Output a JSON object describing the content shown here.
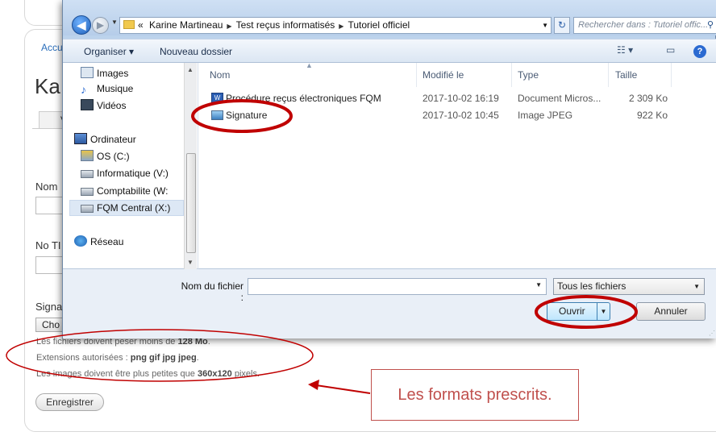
{
  "page": {
    "breadcrumb": "Accu",
    "title": "Ka",
    "tab_stub": "V",
    "field1_label": "Nom",
    "field2_label": "No TI",
    "signature_label": "Signa",
    "choose_button": "Cho",
    "hints": [
      {
        "before": "Les fichiers doivent peser moins de ",
        "bold": "128 Mo",
        "after": "."
      },
      {
        "before": "Extensions autorisées : ",
        "bold": "png gif jpg jpeg",
        "after": "."
      },
      {
        "before": "Les images doivent être plus petites que ",
        "bold": "360x120",
        "after": " pixels."
      }
    ],
    "save_button": "Enregistrer"
  },
  "dialog": {
    "address_parts": [
      "Karine Martineau",
      "Test reçus informatisés",
      "Tutoriel officiel"
    ],
    "address_prefix": "«",
    "search_placeholder": "Rechercher dans : Tutoriel offic...",
    "toolbar": {
      "organize": "Organiser ▾",
      "new_folder": "Nouveau dossier"
    },
    "nav_items": [
      {
        "label": "Images",
        "icon": "pictures-icon"
      },
      {
        "label": "Musique",
        "icon": "music-icon"
      },
      {
        "label": "Vidéos",
        "icon": "video-icon"
      },
      {
        "label": "Ordinateur",
        "icon": "computer-icon"
      },
      {
        "label": "OS (C:)",
        "icon": "drive-icon"
      },
      {
        "label": "Informatique (V:)",
        "icon": "network-drive-icon"
      },
      {
        "label": "Comptabilite (W:",
        "icon": "network-drive-icon"
      },
      {
        "label": "FQM Central (X:)",
        "icon": "network-drive-icon"
      },
      {
        "label": "Réseau",
        "icon": "network-icon"
      }
    ],
    "columns": {
      "name": "Nom",
      "modified": "Modifié le",
      "type": "Type",
      "size": "Taille"
    },
    "files": [
      {
        "name": "Procédure reçus électroniques FQM",
        "modified": "2017-10-02 16:19",
        "type": "Document Micros...",
        "size": "2 309 Ko",
        "icon": "word-document-icon"
      },
      {
        "name": "Signature",
        "modified": "2017-10-02 10:45",
        "type": "Image JPEG",
        "size": "922 Ko",
        "icon": "image-file-icon"
      }
    ],
    "filename_label": "Nom du fichier :",
    "filename_value": "",
    "filter": "Tous les fichiers",
    "open_button": "Ouvrir",
    "cancel_button": "Annuler"
  },
  "annotation": {
    "callout": "Les formats prescrits.",
    "color": "#c00000"
  }
}
